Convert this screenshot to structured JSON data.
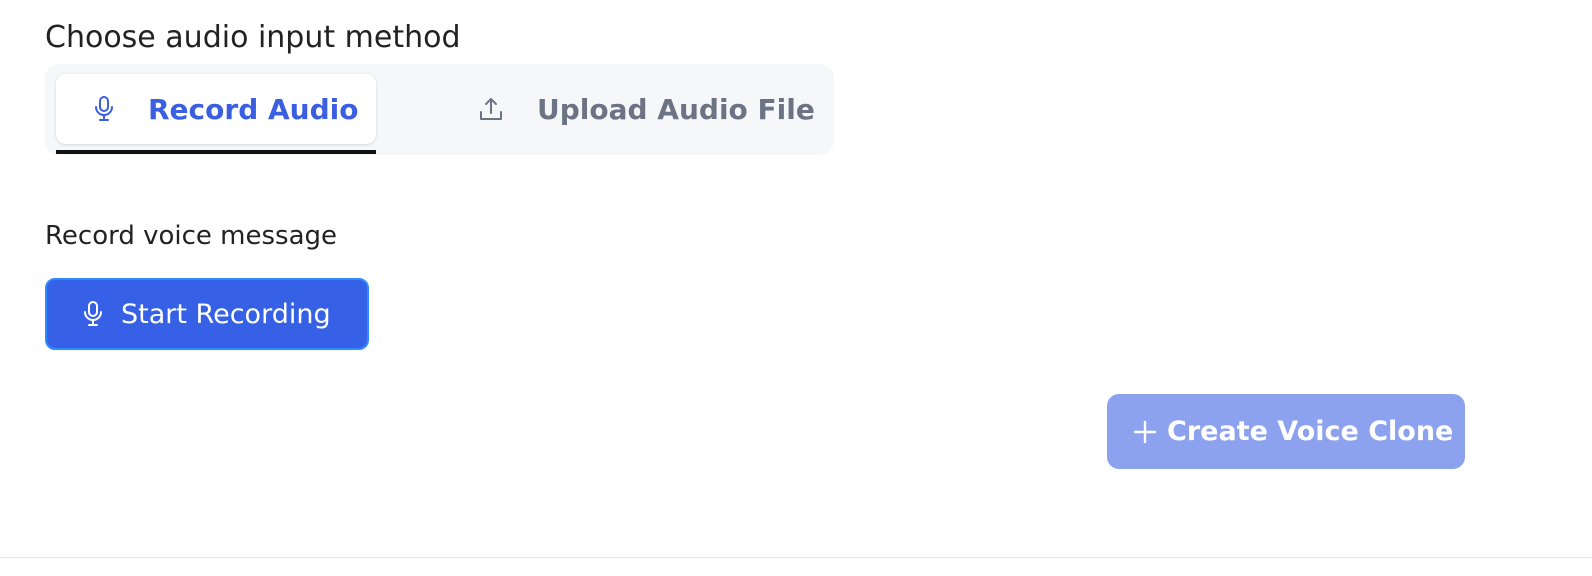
{
  "input_method": {
    "heading": "Choose audio input method",
    "tabs": [
      {
        "label": "Record Audio",
        "icon": "microphone-icon",
        "selected": true
      },
      {
        "label": "Upload Audio File",
        "icon": "upload-icon",
        "selected": false
      }
    ]
  },
  "recorder": {
    "heading": "Record voice message",
    "start_label": "Start Recording",
    "start_icon": "microphone-icon"
  },
  "actions": {
    "create_label": "Create Voice Clone",
    "create_icon": "plus-icon",
    "create_enabled": false
  },
  "colors": {
    "accent": "#3661e6",
    "accent_text": "#3a5fe0",
    "accent_disabled": "#8ca2ee",
    "muted_text": "#6b7385",
    "tab_track": "#f6f7f9"
  }
}
